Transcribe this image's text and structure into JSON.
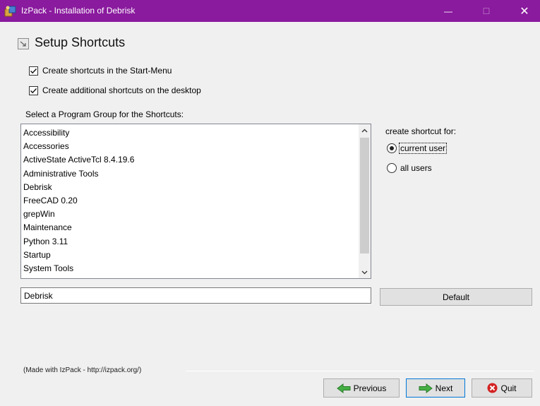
{
  "window": {
    "title": "IzPack - Installation of Debrisk",
    "minimize_glyph": "—",
    "maximize_glyph": "☐",
    "close_glyph": "✕"
  },
  "panel": {
    "heading": "Setup Shortcuts",
    "start_menu_checkbox": {
      "label": "Create shortcuts in the Start-Menu",
      "checked": true
    },
    "desktop_checkbox": {
      "label": "Create additional shortcuts on the desktop",
      "checked": true
    },
    "program_group_label": "Select a Program Group for the Shortcuts:",
    "program_groups": [
      "Accessibility",
      "Accessories",
      "ActiveState ActiveTcl 8.4.19.6",
      "Administrative Tools",
      "Debrisk",
      "FreeCAD 0.20",
      "grepWin",
      "Maintenance",
      "Python 3.11",
      "Startup",
      "System Tools"
    ],
    "shortcut_for_label": "create shortcut for:",
    "current_user_label": "current user",
    "all_users_label": "all users",
    "selected_scope": "current user",
    "group_name_value": "Debrisk",
    "default_button": "Default"
  },
  "footer": {
    "made_with": "(Made with IzPack - http://izpack.org/)",
    "previous_button": "Previous",
    "next_button": "Next",
    "quit_button": "Quit"
  },
  "colors": {
    "titlebar": "#8a1a9e",
    "client_background": "#f0f0f0",
    "next_arrow": "#3aa33a",
    "quit_icon": "#d32222"
  },
  "icons": {
    "app": "izpack-app-icon",
    "heading": "shortcut-icon",
    "previous": "arrow-left-icon",
    "next": "arrow-right-icon",
    "quit": "close-circle-icon"
  }
}
